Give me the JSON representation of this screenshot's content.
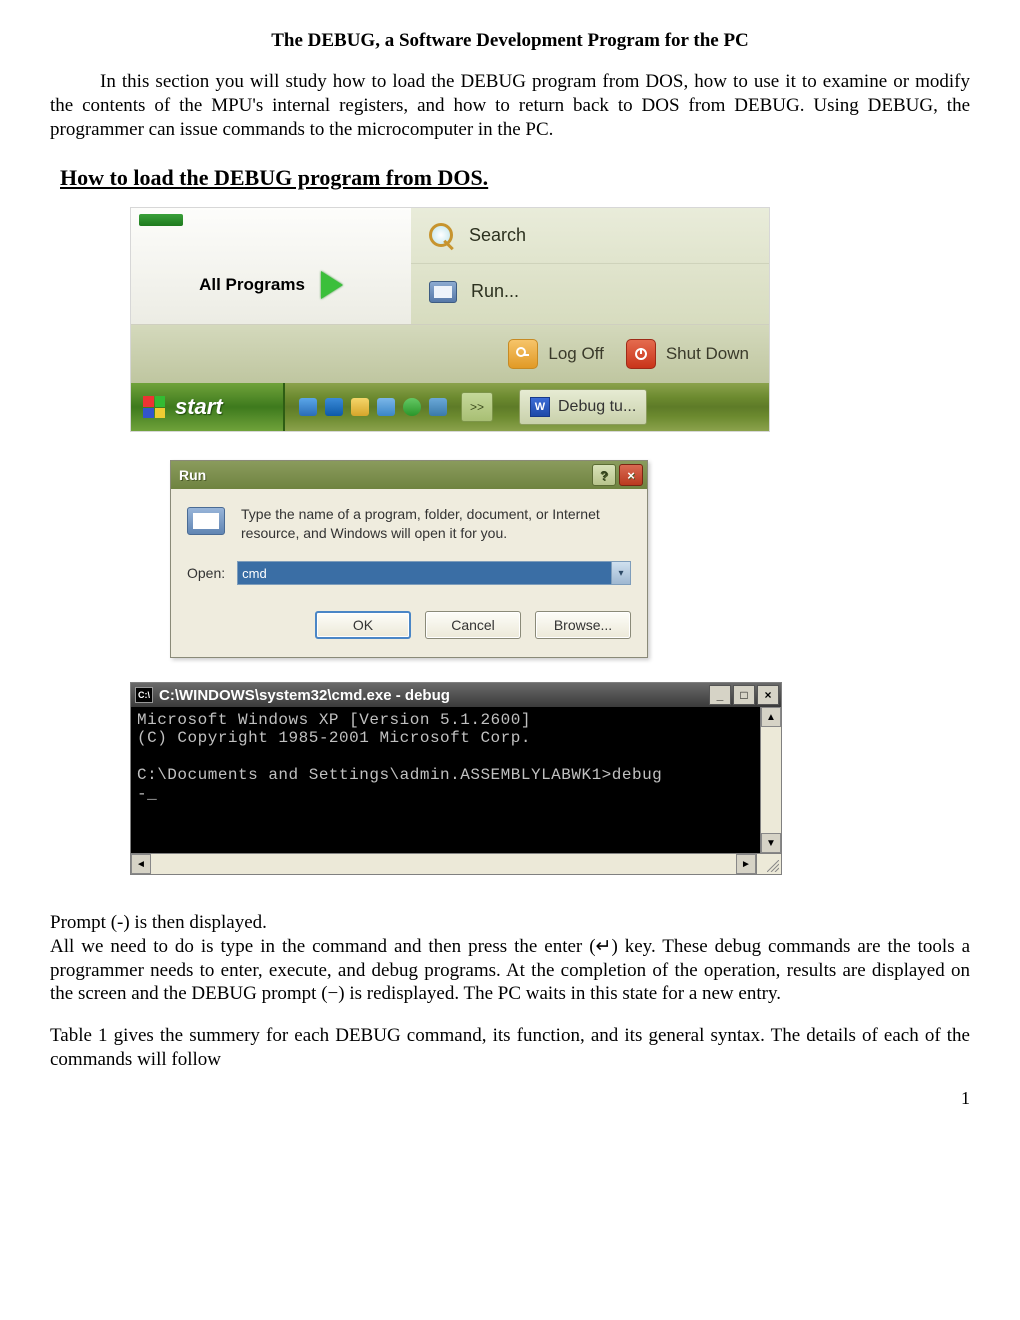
{
  "doc": {
    "title": "The DEBUG, a Software Development Program for the PC",
    "intro": "In this section you will study how to load the DEBUG program from DOS, how to use it to examine or modify the contents of the MPU's internal registers, and how to return back to DOS from DEBUG. Using DEBUG, the programmer can issue commands to the microcomputer in the PC.",
    "section_heading": "How to load the DEBUG program from DOS.",
    "prompt_line": "Prompt (-) is then displayed.",
    "explain": "All we need to do is type in the command and then press the enter (↵) key. These debug commands are the tools a programmer needs to enter, execute, and debug programs. At the completion of the operation, results are displayed on the screen and the DEBUG prompt (−) is redisplayed. The PC waits in this state for a new entry.",
    "table_intro": "Table 1 gives the summery for each DEBUG command, its function, and its general syntax. The details of each of the commands will follow",
    "page_number": "1"
  },
  "startmenu": {
    "all_programs": "All Programs",
    "search": "Search",
    "run": "Run...",
    "log_off": "Log Off",
    "shut_down": "Shut Down",
    "start": "start",
    "more": ">>",
    "task_label": "Debug tu..."
  },
  "run_dialog": {
    "title": "Run",
    "help": "?",
    "close": "×",
    "desc": "Type the name of a program, folder, document, or Internet resource, and Windows will open it for you.",
    "open_label": "Open:",
    "value": "cmd",
    "ok": "OK",
    "cancel": "Cancel",
    "browse": "Browse..."
  },
  "cmd": {
    "title": "C:\\WINDOWS\\system32\\cmd.exe - debug",
    "ico": "C:\\",
    "min": "_",
    "max": "□",
    "close": "×",
    "line1": "Microsoft Windows XP [Version 5.1.2600]",
    "line2": "(C) Copyright 1985-2001 Microsoft Corp.",
    "line3": "",
    "line4": "C:\\Documents and Settings\\admin.ASSEMBLYLABWK1>debug",
    "line5": "-_",
    "up": "▲",
    "down": "▼",
    "left": "◄",
    "right": "►"
  }
}
